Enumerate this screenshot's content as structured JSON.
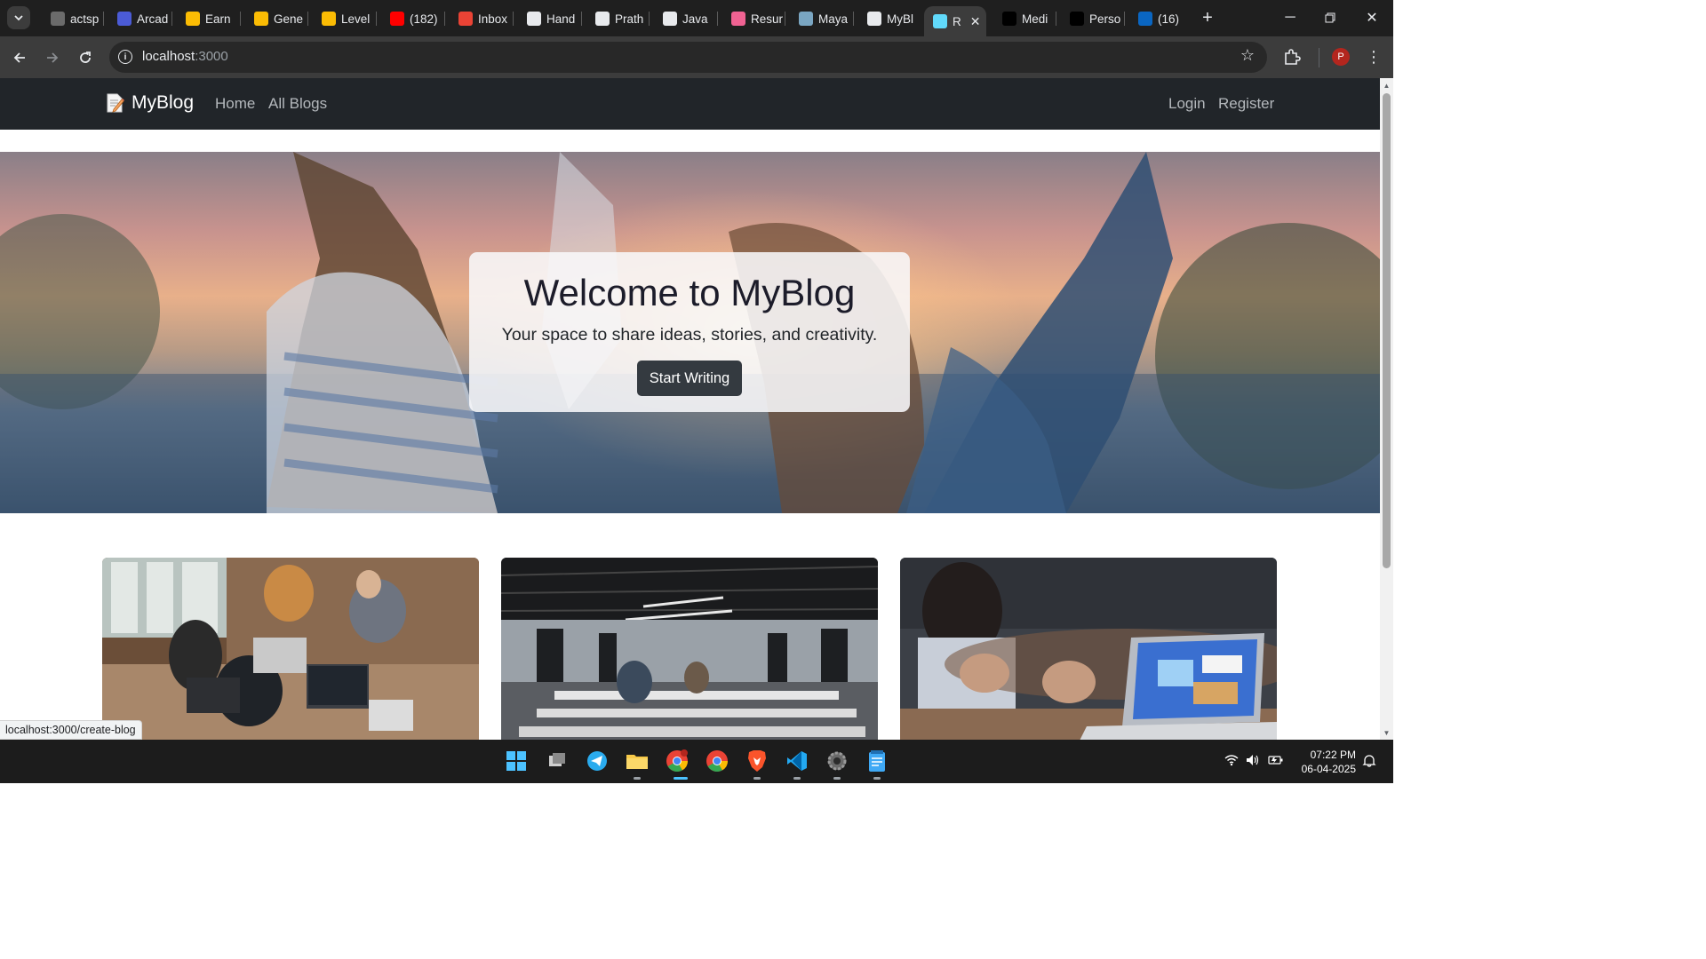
{
  "browser": {
    "tabs": [
      {
        "title": "actsp",
        "favicon_color": "#6b6b6b"
      },
      {
        "title": "Arcad",
        "favicon_color": "#4b5bd6"
      },
      {
        "title": "Earn",
        "favicon_color": "#fbbc04"
      },
      {
        "title": "Gene",
        "favicon_color": "#fbbc04"
      },
      {
        "title": "Level",
        "favicon_color": "#fbbc04"
      },
      {
        "title": "(182)",
        "favicon_color": "#ff0000"
      },
      {
        "title": "Inbox",
        "favicon_color": "#ea4335"
      },
      {
        "title": "Hand",
        "favicon_color": "#e8eaed"
      },
      {
        "title": "Prath",
        "favicon_color": "#e8eaed"
      },
      {
        "title": "Java",
        "favicon_color": "#e8eaed"
      },
      {
        "title": "Resur",
        "favicon_color": "#f06292"
      },
      {
        "title": "Maya",
        "favicon_color": "#7aa6c2"
      },
      {
        "title": "MyBl",
        "favicon_color": "#e8eaed"
      },
      {
        "title": "R",
        "favicon_color": "#61dafb",
        "active": true
      },
      {
        "title": "Medi",
        "favicon_color": "#000000"
      },
      {
        "title": "Perso",
        "favicon_color": "#000000"
      },
      {
        "title": "(16)",
        "favicon_color": "#0a66c2"
      }
    ],
    "url_host": "localhost",
    "url_port": ":3000",
    "profile_initial": "P",
    "status_url": "localhost:3000/create-blog"
  },
  "site": {
    "brand": "MyBlog",
    "nav_left": [
      "Home",
      "All Blogs"
    ],
    "nav_right": [
      "Login",
      "Register"
    ],
    "hero": {
      "title": "Welcome to MyBlog",
      "subtitle": "Your space to share ideas, stories, and creativity.",
      "cta": "Start Writing"
    },
    "cards": [
      {
        "image": "team-working-at-laptops"
      },
      {
        "image": "open-office-floor"
      },
      {
        "image": "person-gesturing-at-laptop"
      }
    ]
  },
  "taskbar": {
    "apps": [
      "windows-start",
      "task-view",
      "telegram",
      "file-explorer",
      "chrome-profile",
      "chrome",
      "brave",
      "vscode",
      "settings",
      "notepad"
    ],
    "time": "07:22 PM",
    "date": "06-04-2025"
  },
  "colors": {
    "site_nav_bg": "#212529",
    "cta_bg": "#343a40",
    "chrome_tabstrip": "#1f1f1f",
    "chrome_toolbar": "#3c3c3c"
  }
}
